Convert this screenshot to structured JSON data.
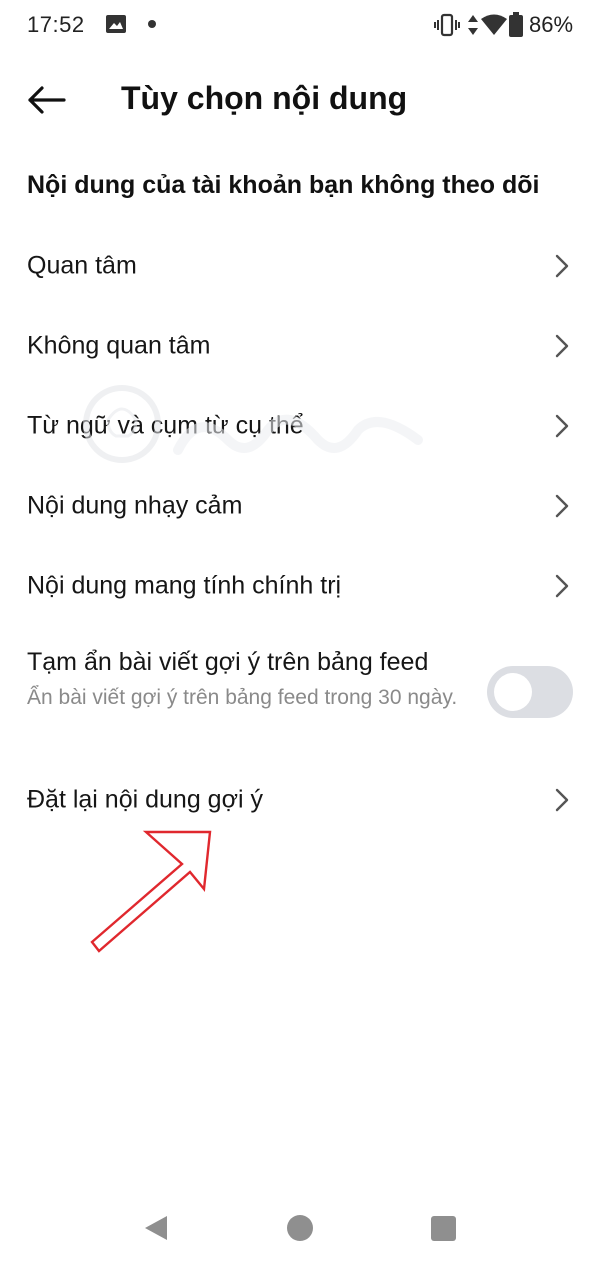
{
  "status_bar": {
    "time": "17:52",
    "battery": "86%",
    "icons": [
      "gallery-icon",
      "dot-icon",
      "vibrate-icon",
      "data-icon",
      "wifi-icon",
      "battery-icon"
    ]
  },
  "header": {
    "back_icon": "arrow-left-icon",
    "title": "Tùy chọn nội dung"
  },
  "section": {
    "title": "Nội dung của tài khoản bạn không theo dõi"
  },
  "menu_items": [
    {
      "label": "Quan tâm",
      "icon": "chevron-right-icon"
    },
    {
      "label": "Không quan tâm",
      "icon": "chevron-right-icon"
    },
    {
      "label": "Từ ngữ và cụm từ cụ thể",
      "icon": "chevron-right-icon"
    },
    {
      "label": "Nội dung nhạy cảm",
      "icon": "chevron-right-icon"
    },
    {
      "label": "Nội dung mang tính chính trị",
      "icon": "chevron-right-icon"
    }
  ],
  "toggle_item": {
    "title": "Tạm ẩn bài viết gợi ý trên bảng feed",
    "description": "Ẩn bài viết gợi ý trên bảng feed trong 30 ngày.",
    "enabled": false
  },
  "reset_item": {
    "label": "Đặt lại nội dung gợi ý",
    "icon": "chevron-right-icon"
  },
  "nav_bar": {
    "icons": [
      "nav-back-icon",
      "nav-home-icon",
      "nav-recents-icon"
    ]
  },
  "colors": {
    "text": "#161616",
    "secondary_text": "#8a8a8a",
    "toggle_off": "#dcdee3",
    "annotation": "#e0282e",
    "nav_icon": "#8f8f8f"
  }
}
